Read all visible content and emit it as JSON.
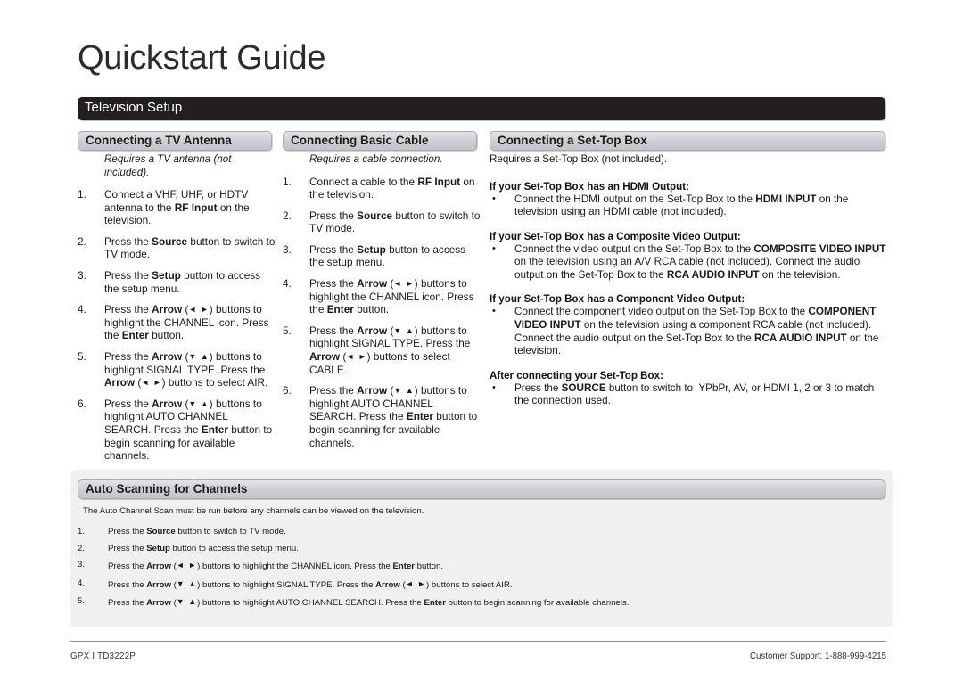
{
  "document": {
    "title": "Quickstart Guide",
    "section_bar": "Television Setup"
  },
  "columns": [
    {
      "header": "Connecting a TV Antenna",
      "intro": "Requires a TV antenna (not included).",
      "intro_style": "italic",
      "steps": [
        {
          "num": "1.",
          "text": "Connect a VHF, UHF, or HDTV antenna to the <b>RF Input</b> on the television."
        },
        {
          "num": "2.",
          "text": "Press the <b>Source</b> button to switch to TV mode."
        },
        {
          "num": "3.",
          "text": "Press the <b>Setup</b> button to access the setup menu."
        },
        {
          "num": "4.",
          "text": "Press the <b>Arrow</b> (<span class=\"arw\">&#9668; &#9658;</span>) buttons to highlight the CHANNEL icon. Press the <b>Enter</b> button."
        },
        {
          "num": "5.",
          "text": "Press the <b>Arrow</b> (<span class=\"arw\">&#9660; &#9650;</span>) buttons to highlight SIGNAL TYPE. Press the <b>Arrow</b> (<span class=\"arw\">&#9668; &#9658;</span>) buttons to select AIR."
        },
        {
          "num": "6.",
          "text": "Press the <b>Arrow</b> (<span class=\"arw\">&#9660; &#9650;</span>) buttons to highlight AUTO CHANNEL SEARCH. Press the <b>Enter</b> button to begin scanning for available channels."
        }
      ]
    },
    {
      "header": "Connecting Basic Cable",
      "intro": "Requires a cable connection.",
      "intro_style": "italic",
      "steps": [
        {
          "num": "1.",
          "text": "Connect a cable to the <b>RF Input</b> on the television."
        },
        {
          "num": "2.",
          "text": "Press the <b>Source</b> button to switch to TV mode."
        },
        {
          "num": "3.",
          "text": "Press the <b>Setup</b> button to access the setup menu."
        },
        {
          "num": "4.",
          "text": "Press the <b>Arrow</b> (<span class=\"arw\">&#9668; &#9658;</span>) buttons to highlight the CHANNEL icon. Press the <b>Enter</b> button."
        },
        {
          "num": "5.",
          "text": "Press the <b>Arrow</b> (<span class=\"arw\">&#9660; &#9650;</span>) buttons to highlight SIGNAL TYPE. Press the <b>Arrow</b> (<span class=\"arw\">&#9668; &#9658;</span>) buttons to select CABLE."
        },
        {
          "num": "6.",
          "text": "Press the <b>Arrow</b> (<span class=\"arw\">&#9660; &#9650;</span>) buttons to highlight AUTO CHANNEL SEARCH. Press the <b>Enter</b> button to begin scanning for available channels."
        }
      ]
    },
    {
      "header": "Connecting a Set-Top Box",
      "intro": "Requires a Set-Top Box (not included).",
      "intro_style": "plain",
      "groups": [
        {
          "heading": "If your Set-Top Box has an HDMI Output:",
          "bullets": [
            "Connect the HDMI output on the Set-Top Box to the <b>HDMI INPUT</b> on the television using an HDMI cable (not included)."
          ]
        },
        {
          "heading": "If your Set-Top Box has a Composite Video Output:",
          "bullets": [
            "Connect the video output on the Set-Top Box to the <b>COMPOSITE VIDEO INPUT</b> on the television using an A/V RCA cable (not included). Connect the audio output on the Set-Top Box to the <b>RCA AUDIO INPUT</b> on the television."
          ]
        },
        {
          "heading": "If your Set-Top Box has a Component Video Output:",
          "bullets": [
            "Connect the component video output on the Set-Top Box to the <b>COMPONENT&nbsp; VIDEO INPUT</b> on the television using a component RCA cable (not included). Connect the audio output on the Set-Top Box to the <b>RCA AUDIO INPUT</b> on the television."
          ]
        },
        {
          "heading": "After connecting your Set-Top Box:",
          "bullets": [
            "Press the <b>SOURCE</b> button to switch to&nbsp; YPbPr, AV, or HDMI 1, 2 or 3 to match the connection used."
          ]
        }
      ]
    }
  ],
  "auto_scan": {
    "header": "Auto Scanning for Channels",
    "intro": "The Auto Channel Scan must be run before any channels can be viewed on the television.",
    "steps": [
      {
        "num": "1.",
        "text": "Press the <b>Source</b> button to switch to TV mode."
      },
      {
        "num": "2.",
        "text": "Press the <b>Setup</b> button to access the setup menu."
      },
      {
        "num": "3.",
        "text": "Press the <b>Arrow</b> (<span class=\"arw\">&#9668; &#9658;</span>) buttons to highlight the CHANNEL icon. Press the <b>Enter</b> button."
      },
      {
        "num": "4.",
        "text": "Press the <b>Arrow</b> (<span class=\"arw\">&#9660; &#9650;</span>) buttons to highlight SIGNAL TYPE. Press the <b>Arrow</b> (<span class=\"arw\">&#9668; &#9658;</span>) buttons to select AIR."
      },
      {
        "num": "5.",
        "text": "Press the <b>Arrow</b> (<span class=\"arw\">&#9660; &#9650;</span>) buttons to highlight AUTO CHANNEL SEARCH. Press the <b>Enter</b> button to begin scanning for available channels."
      }
    ]
  },
  "footer": {
    "left": "GPX  I  TD3222P",
    "right": "Customer Support: 1-888-999-4215"
  },
  "colors": {
    "bar_black": "#231f20",
    "pill_gradient_top": "#e3e3e6",
    "pill_gradient_bottom": "#c3c4ca",
    "pill_border": "#a9aab1",
    "panel_bg": "#f0f0f1",
    "text": "#1a1a1a"
  }
}
